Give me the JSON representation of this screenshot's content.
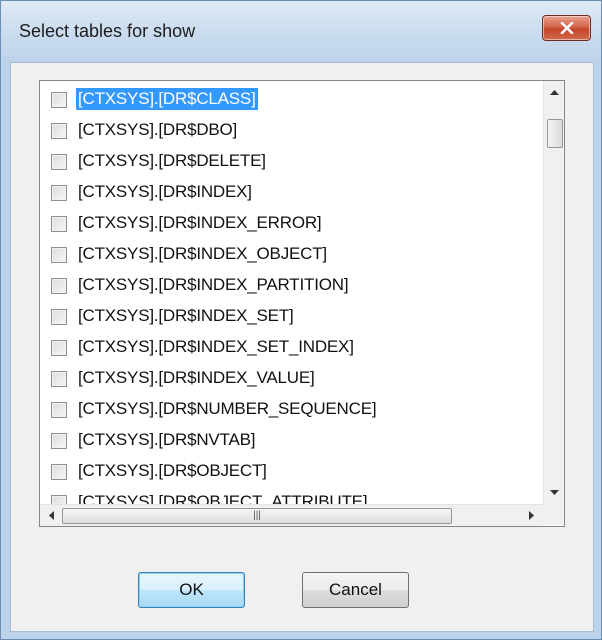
{
  "window": {
    "title": "Select tables for show"
  },
  "list": {
    "items": [
      {
        "label": "[CTXSYS].[DR$CLASS]",
        "checked": false,
        "selected": true
      },
      {
        "label": "[CTXSYS].[DR$DBO]",
        "checked": false,
        "selected": false
      },
      {
        "label": "[CTXSYS].[DR$DELETE]",
        "checked": false,
        "selected": false
      },
      {
        "label": "[CTXSYS].[DR$INDEX]",
        "checked": false,
        "selected": false
      },
      {
        "label": "[CTXSYS].[DR$INDEX_ERROR]",
        "checked": false,
        "selected": false
      },
      {
        "label": "[CTXSYS].[DR$INDEX_OBJECT]",
        "checked": false,
        "selected": false
      },
      {
        "label": "[CTXSYS].[DR$INDEX_PARTITION]",
        "checked": false,
        "selected": false
      },
      {
        "label": "[CTXSYS].[DR$INDEX_SET]",
        "checked": false,
        "selected": false
      },
      {
        "label": "[CTXSYS].[DR$INDEX_SET_INDEX]",
        "checked": false,
        "selected": false
      },
      {
        "label": "[CTXSYS].[DR$INDEX_VALUE]",
        "checked": false,
        "selected": false
      },
      {
        "label": "[CTXSYS].[DR$NUMBER_SEQUENCE]",
        "checked": false,
        "selected": false
      },
      {
        "label": "[CTXSYS].[DR$NVTAB]",
        "checked": false,
        "selected": false
      },
      {
        "label": "[CTXSYS].[DR$OBJECT]",
        "checked": false,
        "selected": false
      },
      {
        "label": "[CTXSYS].[DR$OBJECT_ATTRIBUTE]",
        "checked": false,
        "selected": false
      }
    ]
  },
  "buttons": {
    "ok": "OK",
    "cancel": "Cancel"
  },
  "colors": {
    "selection": "#3399ff",
    "close_button": "#c4452c"
  }
}
